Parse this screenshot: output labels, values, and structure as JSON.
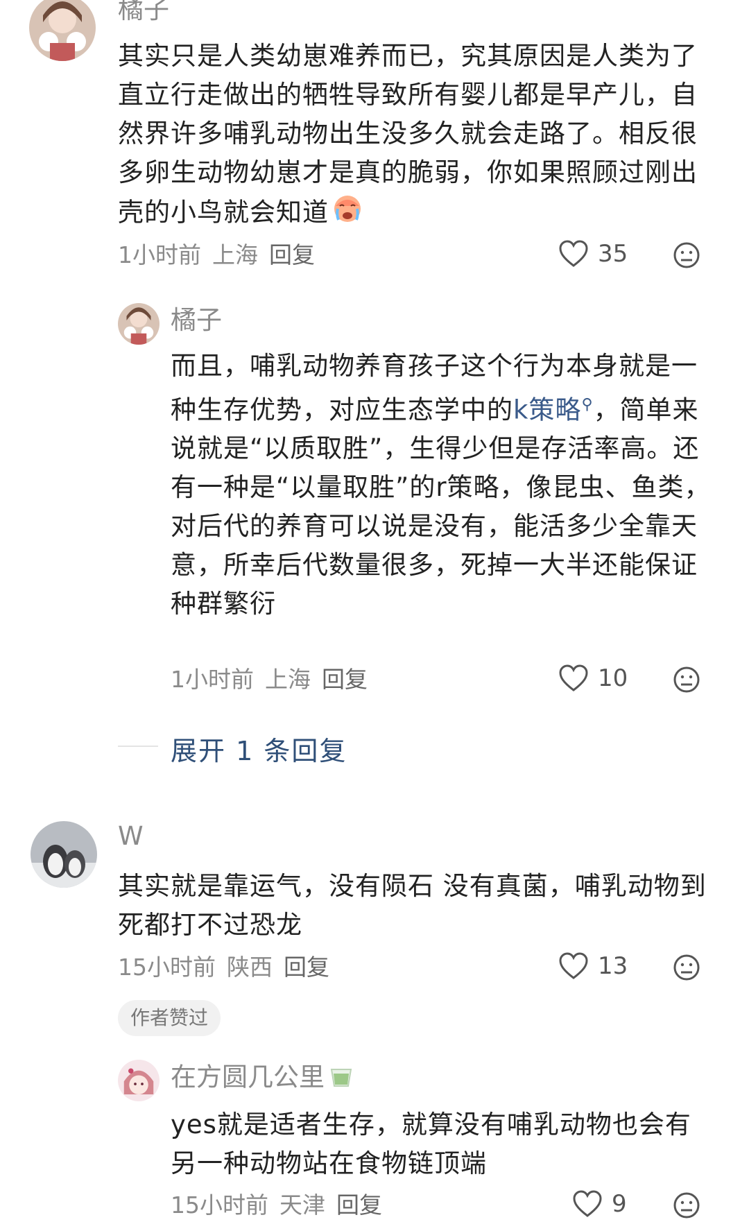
{
  "comments": [
    {
      "user": "橘子",
      "text": "其实只是人类幼崽难养而已，究其原因是人类为了直立行走做出的牺牲导致所有婴儿都是早产儿，自然界许多哺乳动物出生没多久就会走路了。相反很多卵生动物幼崽才是真的脆弱，你如果照顾过刚出壳的小鸟就会知道",
      "emoji": "crying-face",
      "time": "1小时前",
      "location": "上海",
      "reply_label": "回复",
      "likes": "35"
    },
    {
      "user": "橘子",
      "text_before_link": "而且，哺乳动物养育孩子这个行为本身就是一种生存优势，对应生态学中的",
      "link_text": "k策略",
      "text_after_link": "，简单来说就是“以质取胜”，生得少但是存活率高。还有一种是“以量取胜”的r策略，像昆虫、鱼类，对后代的养育可以说是没有，能活多少全靠天意，所幸后代数量很多，死掉一大半还能保证种群繁衍",
      "time": "1小时前",
      "location": "上海",
      "reply_label": "回复",
      "likes": "10"
    },
    {
      "user": "W",
      "text": "其实就是靠运气，没有陨石 没有真菌，哺乳动物到死都打不过恐龙",
      "time": "15小时前",
      "location": "陕西",
      "reply_label": "回复",
      "likes": "13",
      "badge": "作者赞过"
    },
    {
      "user": "在方圆几公里",
      "user_emoji": "tea-cup",
      "text": "yes就是适者生存，就算没有哺乳动物也会有另一种动物站在食物链顶端",
      "time": "15小时前",
      "location": "天津",
      "reply_label": "回复",
      "likes": "9"
    }
  ],
  "expand_replies": "展开 1 条回复",
  "colors": {
    "link": "#3a5a8a",
    "meta": "#8a8a8a",
    "text": "#222222"
  }
}
